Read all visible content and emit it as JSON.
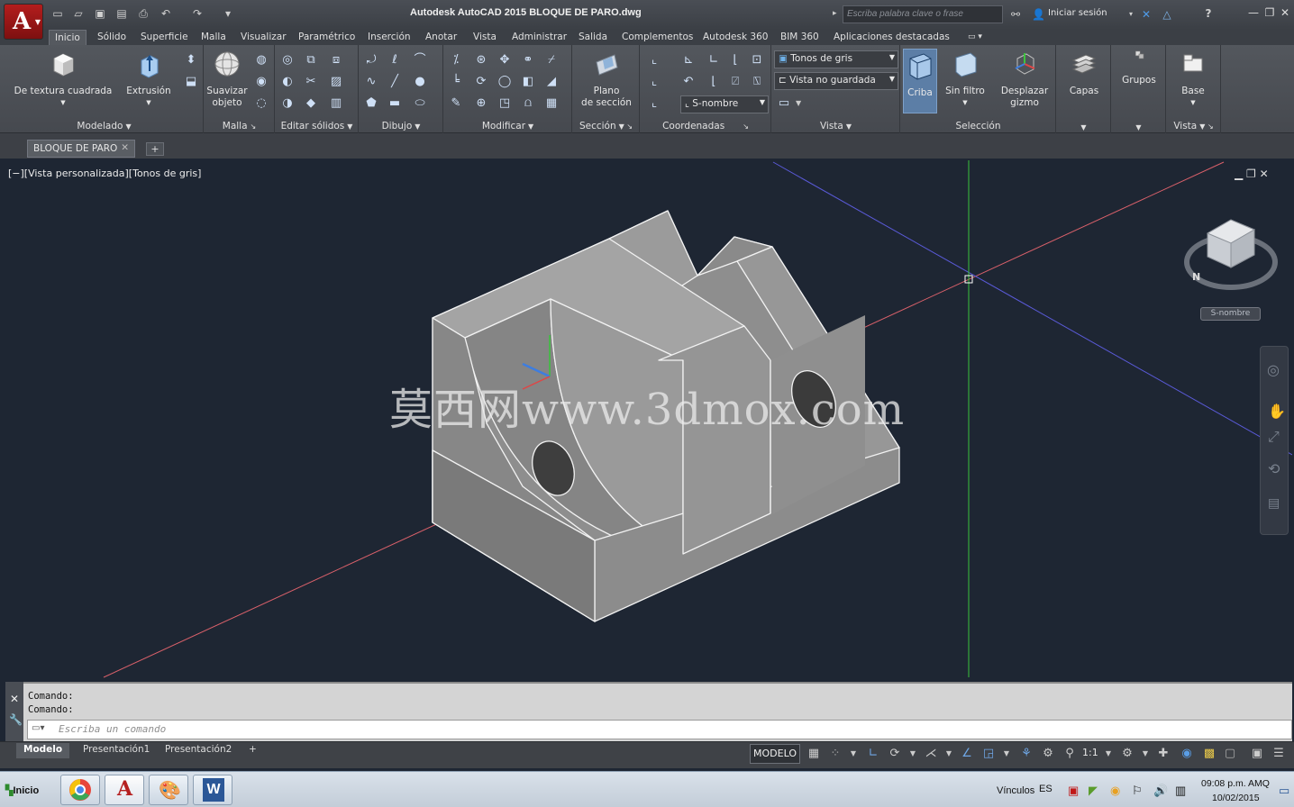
{
  "app": {
    "title": "Autodesk AutoCAD 2015    BLOQUE DE PARO.dwg",
    "search_placeholder": "Escriba palabra clave o frase",
    "signin": "Iniciar sesión"
  },
  "ribbon_tabs": [
    "Inicio",
    "Sólido",
    "Superficie",
    "Malla",
    "Visualizar",
    "Paramétrico",
    "Inserción",
    "Anotar",
    "Vista",
    "Administrar",
    "Salida",
    "Complementos",
    "Autodesk 360",
    "BIM 360",
    "Aplicaciones destacadas"
  ],
  "ribbon": {
    "modelado": {
      "title": "Modelado",
      "box": "De textura cuadrada",
      "extrude": "Extrusión"
    },
    "malla": {
      "title": "Malla",
      "smooth": "Suavizar\nobjeto"
    },
    "editar": {
      "title": "Editar sólidos"
    },
    "dibujo": {
      "title": "Dibujo"
    },
    "modificar": {
      "title": "Modificar"
    },
    "seccion": {
      "title": "Sección",
      "plane": "Plano\nde sección"
    },
    "coordenadas": {
      "title": "Coordenadas",
      "ucs_combo": "S-nombre"
    },
    "vista": {
      "title": "Vista",
      "style_combo": "Tonos de gris",
      "view_combo": "Vista no guardada"
    },
    "seleccion": {
      "title": "Selección",
      "cull": "Criba",
      "filter": "Sin filtro",
      "gizmo": "Desplazar\ngizmo"
    },
    "capas": {
      "title": "Capas"
    },
    "grupos": {
      "title": "Grupos"
    },
    "base": {
      "title": "Vista",
      "base": "Base"
    }
  },
  "file_tab": "BLOQUE DE PARO",
  "viewport": {
    "label": "[−][Vista personalizada][Tonos de gris]",
    "viewcube_ucs": "S-nombre",
    "watermark": "莫西网www.3dmox.com"
  },
  "command": {
    "history": [
      "Comando:",
      "Comando:"
    ],
    "placeholder": "Escriba un comando"
  },
  "layout_tabs": [
    "Modelo",
    "Presentación1",
    "Presentación2"
  ],
  "status": {
    "model": "MODELO",
    "scale": "1:1"
  },
  "taskbar": {
    "start": "Inicio",
    "vinculos": "Vínculos",
    "lang": "ES",
    "time": "09:08 p.m. AMQ",
    "date": "10/02/2015"
  }
}
